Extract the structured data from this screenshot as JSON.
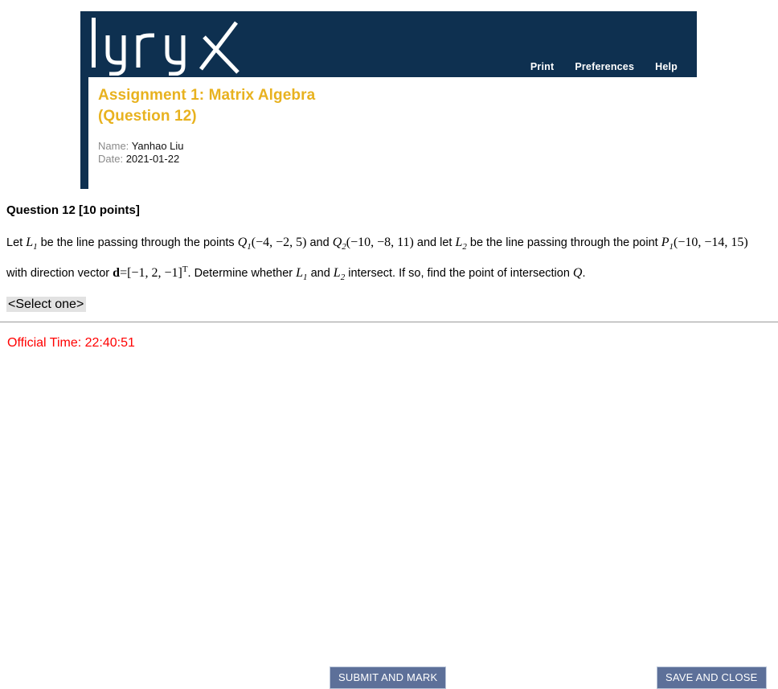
{
  "brand": {
    "logo_text": "lyryx",
    "navy": "#0e3050",
    "gold": "#e8b21f"
  },
  "nav": {
    "links": [
      {
        "label": "Print"
      },
      {
        "label": "Preferences"
      },
      {
        "label": "Help"
      }
    ]
  },
  "assignment": {
    "title_line1": "Assignment 1: Matrix Algebra",
    "title_line2": "(Question 12)",
    "name_label": "Name:",
    "name_value": "Yanhao Liu",
    "date_label": "Date:",
    "date_value": "2021-01-22"
  },
  "question": {
    "heading": "Question 12 [10 points]",
    "text_full": "Let L1 be the line passing through the points Q1(−4, −2, 5) and Q2(−10, −8, 11) and let L2 be the line passing through the point P1(−10, −14, 15) with direction vector d=[−1, 2, −1]T. Determine whether L1 and L2 intersect. If so, find the point of intersection Q.",
    "seg_let": "Let ",
    "line1_var": "L",
    "line1_sub": "1",
    "seg_after_l1": " be the line passing through the points ",
    "q1_var": "Q",
    "q1_sub": "1",
    "q1_coords": "(−4, −2, 5)",
    "seg_and": " and ",
    "q2_var": "Q",
    "q2_sub": "2",
    "q2_coords": "(−10, −8, 11)",
    "seg_and_let": " and let ",
    "line2_var": "L",
    "line2_sub": "2",
    "seg_after_l2": " be the line passing through the point ",
    "p1_var": "P",
    "p1_sub": "1",
    "p1_coords": "(−10, −14, 15)",
    "seg_with_dir": " with direction vector ",
    "dir_symbol": "d",
    "dir_equals": "=[−1, 2, −1]",
    "dir_sup": "T",
    "seg_determine": ". Determine whether ",
    "line1b_var": "L",
    "line1b_sub": "1",
    "seg_and2": " and ",
    "line2b_var": "L",
    "line2b_sub": "2",
    "seg_intersect": " intersect. If so, find the point of intersection ",
    "final_q": "Q",
    "seg_period": "."
  },
  "answer": {
    "selected": "<Select one>",
    "options": [
      "<Select one>"
    ]
  },
  "footer": {
    "time_label": "Official Time:",
    "time_value": "22:40:51",
    "time_full": "Official Time: 22:40:51",
    "submit_label": "SUBMIT AND MARK",
    "save_label": "SAVE AND CLOSE"
  }
}
